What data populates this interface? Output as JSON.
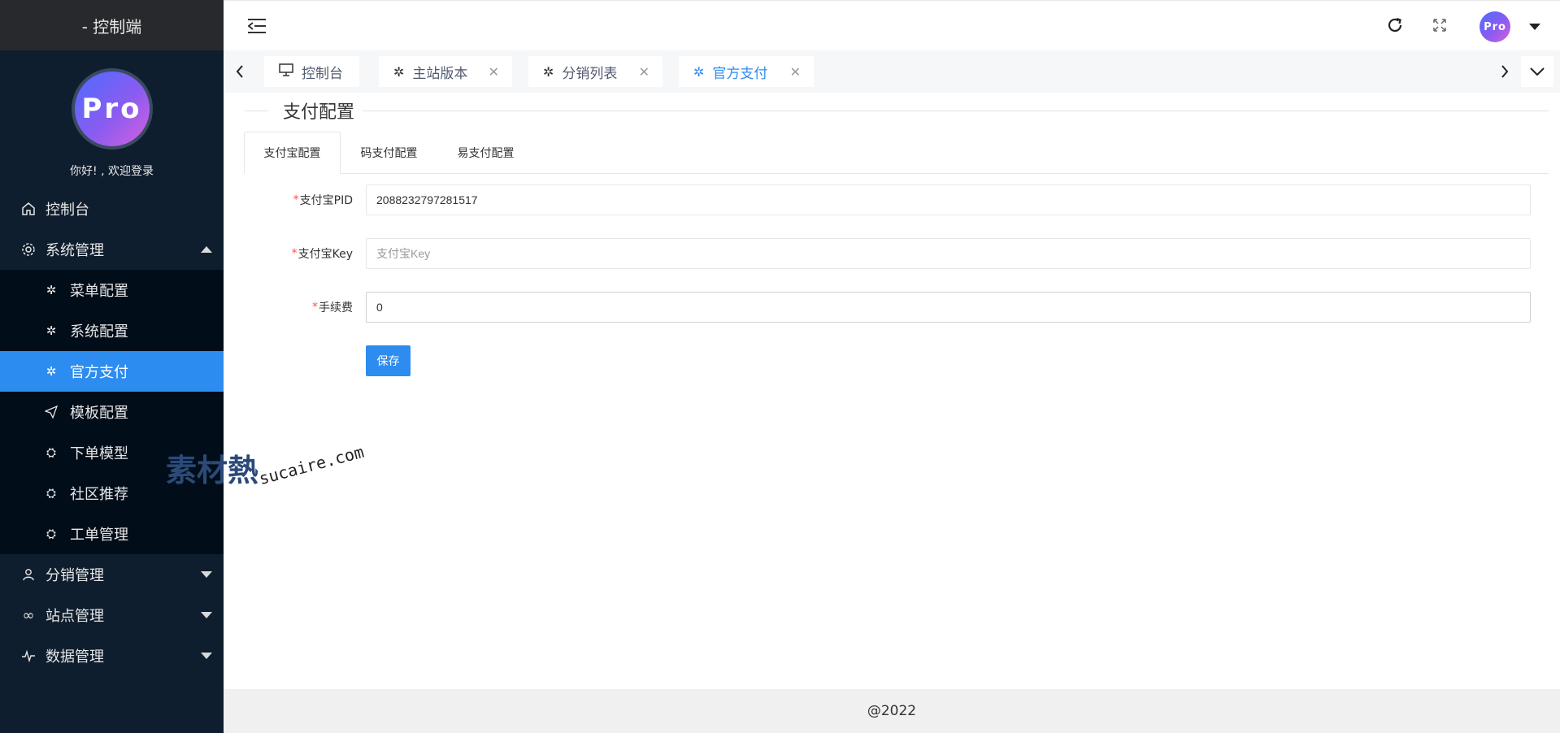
{
  "sidebar": {
    "title": "- 控制端",
    "avatar_text": "Pro",
    "welcome": "你好! , 欢迎登录",
    "menu": {
      "dashboard": "控制台",
      "system": "系统管理",
      "sub": [
        "菜单配置",
        "系统配置",
        "官方支付",
        "模板配置",
        "下单模型",
        "社区推荐",
        "工单管理"
      ],
      "distribution": "分销管理",
      "site": "站点管理",
      "data": "数据管理"
    }
  },
  "topbar": {
    "avatar_text": "Pro"
  },
  "tabs": [
    {
      "label": "控制台"
    },
    {
      "label": "主站版本"
    },
    {
      "label": "分销列表"
    },
    {
      "label": "官方支付"
    }
  ],
  "content": {
    "section_title": "支付配置",
    "form_tabs": [
      "支付宝配置",
      "码支付配置",
      "易支付配置"
    ],
    "fields": [
      {
        "label": "支付宝PID",
        "value": "2088232797281517",
        "placeholder": ""
      },
      {
        "label": "支付宝Key",
        "value": "",
        "placeholder": "支付宝Key"
      },
      {
        "label": "手续费",
        "value": "0",
        "placeholder": ""
      }
    ],
    "save_label": "保存"
  },
  "watermark": {
    "cn": "素材熱",
    "en": "sucaire.com"
  },
  "footer": "@2022",
  "colors": {
    "sidebar_bg": "#0f1e2e",
    "submenu_bg": "#020d1a",
    "active": "#2d8cf0"
  }
}
